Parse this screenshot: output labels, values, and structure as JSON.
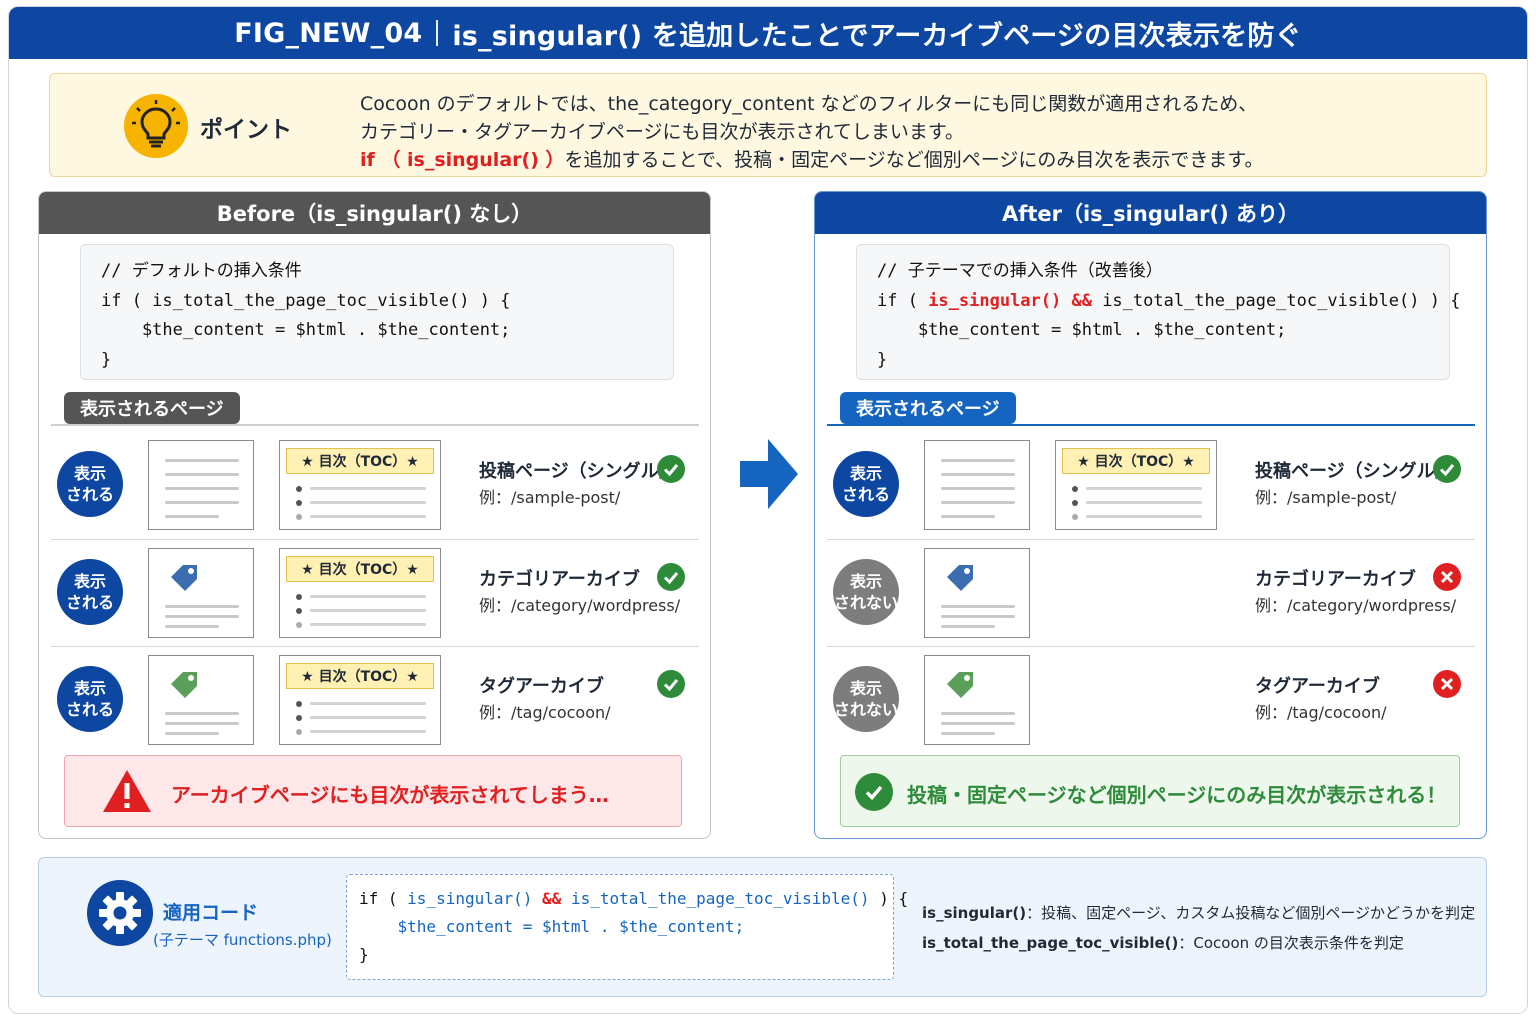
{
  "header": {
    "fig_id": "FIG_NEW_04",
    "title": "is_singular() を追加したことでアーカイブページの目次表示を防ぐ"
  },
  "point": {
    "label": "ポイント",
    "line1": "Cocoon のデフォルトでは、the_category_content などのフィルターにも同じ関数が適用されるため、",
    "line2": "カテゴリー・タグアーカイブページにも目次が表示されてしまいます。",
    "line3_red": "if （ is_singular() ）",
    "line3_rest": "を追加することで、投稿・固定ページなど個別ページにのみ目次を表示できます。"
  },
  "before": {
    "heading": "Before（is_singular() なし）",
    "code": {
      "l1": "// デフォルトの挿入条件",
      "l2": "if ( is_total_the_page_toc_visible() ) {",
      "l3": "    $the_content = $html . $the_content;",
      "l4": "}"
    },
    "shown_tab": "表示されるページ",
    "rows": [
      {
        "badge1": "表示",
        "badge2": "される",
        "toc": "★ 目次（TOC）★",
        "title": "投稿ページ（シングル）",
        "example": "例：/sample-post/"
      },
      {
        "badge1": "表示",
        "badge2": "される",
        "toc": "★ 目次（TOC）★",
        "title": "カテゴリアーカイブ",
        "example": "例：/category/wordpress/"
      },
      {
        "badge1": "表示",
        "badge2": "される",
        "toc": "★ 目次（TOC）★",
        "title": "タグアーカイブ",
        "example": "例：/tag/cocoon/"
      }
    ],
    "alert": "アーカイブページにも目次が表示されてしまう…"
  },
  "after": {
    "heading": "After（is_singular() あり）",
    "code": {
      "l1": "// 子テーマでの挿入条件（改善後）",
      "l2_pre": "if ( ",
      "l2_red": "is_singular() &&",
      "l2_post": " is_total_the_page_toc_visible() ) {",
      "l3": "    $the_content = $html . $the_content;",
      "l4": "}"
    },
    "shown_tab": "表示されるページ",
    "rows": [
      {
        "badge1": "表示",
        "badge2": "される",
        "toc": "★ 目次（TOC）★",
        "title": "投稿ページ（シングル）",
        "example": "例：/sample-post/"
      },
      {
        "badge1": "表示",
        "badge2": "されない",
        "title": "カテゴリアーカイブ",
        "example": "例：/category/wordpress/"
      },
      {
        "badge1": "表示",
        "badge2": "されない",
        "title": "タグアーカイブ",
        "example": "例：/tag/cocoon/"
      }
    ],
    "result": "投稿・固定ページなど個別ページにのみ目次が表示される！"
  },
  "apply": {
    "label": "適用コード",
    "sub": "(子テーマ functions.php)",
    "code": {
      "l1_pre": "if ( ",
      "l1_fn1": "is_singular()",
      "l1_op": " && ",
      "l1_fn2": "is_total_the_page_toc_visible()",
      "l1_post": " ) {",
      "l2": "    $the_content = $html . $the_content;",
      "l3": "}"
    },
    "desc1_term": "is_singular()",
    "desc1_text": "：投稿、固定ページ、カスタム投稿など個別ページかどうかを判定",
    "desc2_term": "is_total_the_page_toc_visible()",
    "desc2_text": "：Cocoon の目次表示条件を判定"
  },
  "colors": {
    "brand_blue": "#0d47a1",
    "accent_red": "#e02020",
    "ok_green": "#2e8b3a",
    "before_gray": "#555555"
  }
}
